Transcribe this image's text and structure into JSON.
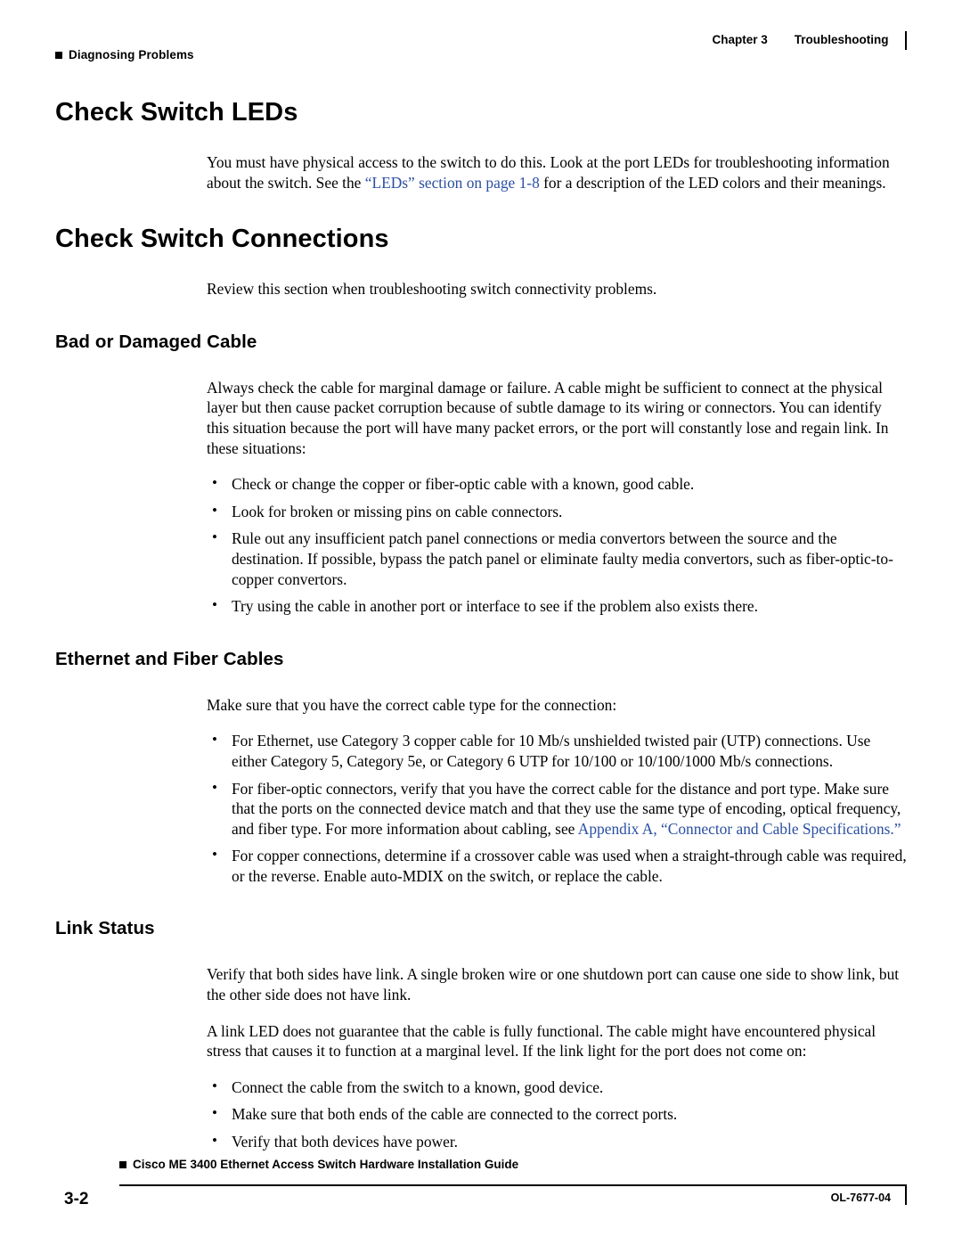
{
  "header": {
    "running_head_left": "Diagnosing Problems",
    "chapter_label": "Chapter 3",
    "chapter_title": "Troubleshooting"
  },
  "sections": {
    "check_switch_leds": {
      "heading": "Check Switch LEDs",
      "para_part1": "You must have physical access to the switch to do this. Look at the port LEDs for troubleshooting information about the switch. See the ",
      "link": "“LEDs” section on page 1-8",
      "para_part2": " for a description of the LED colors and their meanings."
    },
    "check_switch_connections": {
      "heading": "Check Switch Connections",
      "intro": "Review this section when troubleshooting switch connectivity problems."
    },
    "bad_or_damaged_cable": {
      "heading": "Bad or Damaged Cable",
      "intro": "Always check the cable for marginal damage or failure. A cable might be sufficient to connect at the physical layer but then cause packet corruption because of subtle damage to its wiring or connectors. You can identify this situation because the port will have many packet errors, or the port will constantly lose and regain link. In these situations:",
      "bullets": [
        "Check or change the copper or fiber-optic cable with a known, good cable.",
        "Look for broken or missing pins on cable connectors.",
        "Rule out any insufficient patch panel connections or media convertors between the source and the destination. If possible, bypass the patch panel or eliminate faulty media convertors, such as fiber-optic-to-copper convertors.",
        "Try using the cable in another port or interface to see if the problem also exists there."
      ]
    },
    "ethernet_and_fiber_cables": {
      "heading": "Ethernet and Fiber Cables",
      "intro": "Make sure that you have the correct cable type for the connection:",
      "bullet1": "For Ethernet, use Category 3 copper cable for 10 Mb/s unshielded twisted pair (UTP) connections. Use either Category 5, Category 5e, or Category 6 UTP for 10/100 or 10/100/1000 Mb/s connections.",
      "bullet2_part1": "For fiber-optic connectors, verify that you have the correct cable for the distance and port type. Make sure that the ports on the connected device match and that they use the same type of encoding, optical frequency, and fiber type. For more information about cabling, see ",
      "bullet2_link": "Appendix A, “Connector and Cable Specifications.”",
      "bullet3": "For copper connections, determine if a crossover cable was used when a straight-through cable was required, or the reverse. Enable auto-MDIX on the switch, or replace the cable."
    },
    "link_status": {
      "heading": "Link Status",
      "para1": "Verify that both sides have link. A single broken wire or one shutdown port can cause one side to show link, but the other side does not have link.",
      "para2": "A link LED does not guarantee that the cable is fully functional. The cable might have encountered physical stress that causes it to function at a marginal level. If the link light for the port does not come on:",
      "bullets": [
        "Connect the cable from the switch to a known, good device.",
        "Make sure that both ends of the cable are connected to the correct ports.",
        "Verify that both devices have power."
      ]
    }
  },
  "footer": {
    "doc_title": "Cisco ME 3400 Ethernet Access Switch Hardware Installation Guide",
    "page_number": "3-2",
    "doc_number": "OL-7677-04"
  },
  "colors": {
    "link": "#2a4fa2",
    "text": "#000000",
    "background": "#ffffff"
  }
}
